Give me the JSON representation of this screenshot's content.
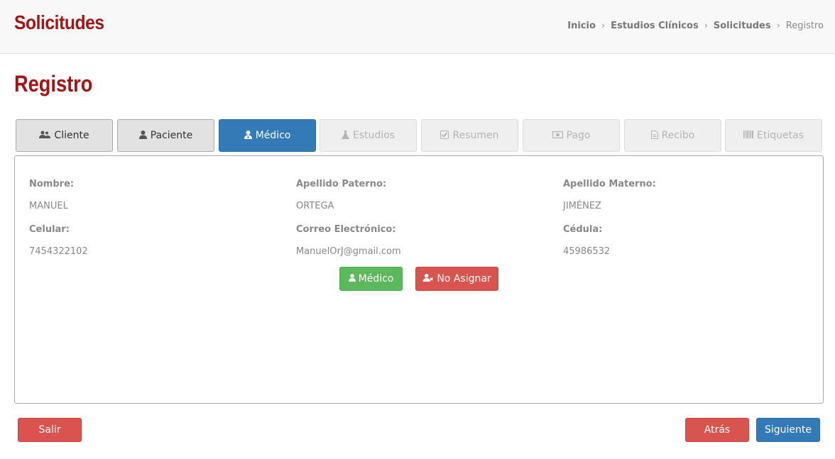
{
  "header": {
    "title": "Solicitudes",
    "breadcrumb": [
      "Inicio",
      "Estudios Clínicos",
      "Solicitudes",
      "Registro"
    ],
    "separator": "›"
  },
  "page": {
    "title": "Registro"
  },
  "tabs": [
    {
      "label": "Cliente",
      "icon": "users-icon",
      "state": "done"
    },
    {
      "label": "Paciente",
      "icon": "user-icon",
      "state": "done"
    },
    {
      "label": "Médico",
      "icon": "user-md-icon",
      "state": "active"
    },
    {
      "label": "Estudios",
      "icon": "flask-icon",
      "state": "disabled"
    },
    {
      "label": "Resumen",
      "icon": "check-square-icon",
      "state": "disabled"
    },
    {
      "label": "Pago",
      "icon": "money-icon",
      "state": "disabled"
    },
    {
      "label": "Recibo",
      "icon": "file-text-icon",
      "state": "disabled"
    },
    {
      "label": "Etiquetas",
      "icon": "barcode-icon",
      "state": "disabled"
    }
  ],
  "doctor": {
    "nombre_label": "Nombre:",
    "nombre": "MANUEL",
    "apellido_paterno_label": "Apellido Paterno:",
    "apellido_paterno": "ORTEGA",
    "apellido_materno_label": "Apellido Materno:",
    "apellido_materno": "JIMÉNEZ",
    "celular_label": "Celular:",
    "celular": "7454322102",
    "correo_label": "Correo Electrónico:",
    "correo": "ManuelOrJ@gmail.com",
    "cedula_label": "Cédula:",
    "cedula": "45986532"
  },
  "actions": {
    "medico_label": "Médico",
    "no_asignar_label": "No Asignar"
  },
  "footer": {
    "salir_label": "Salir",
    "atras_label": "Atrás",
    "siguiente_label": "Siguiente"
  },
  "colors": {
    "brand_red": "#a61414",
    "primary": "#337ab7",
    "success": "#5cb85c",
    "danger": "#d9534f"
  }
}
